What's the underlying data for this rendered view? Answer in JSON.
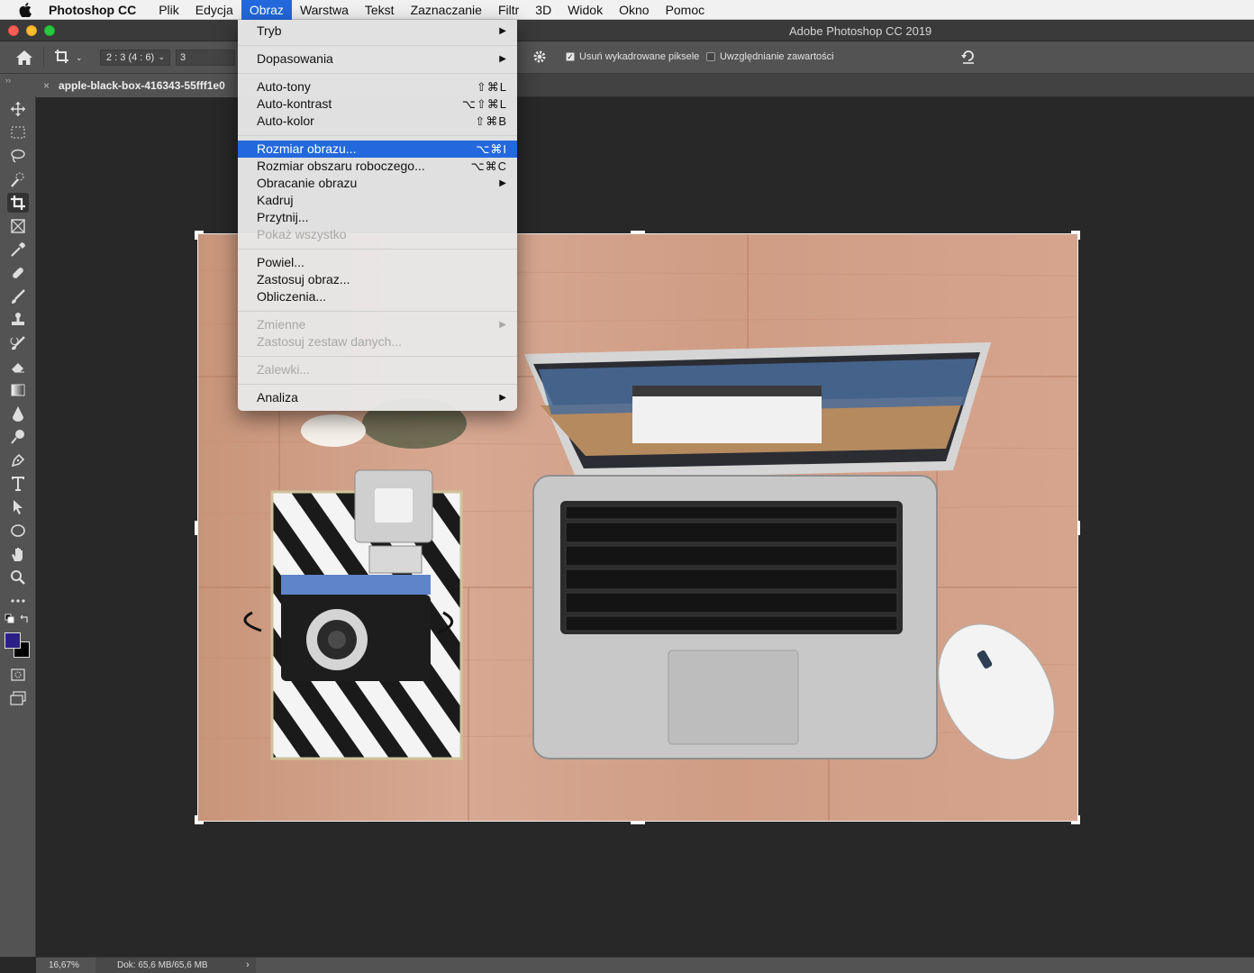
{
  "menubar": {
    "app_name": "Photoshop CC",
    "items": [
      "Plik",
      "Edycja",
      "Obraz",
      "Warstwa",
      "Tekst",
      "Zaznaczanie",
      "Filtr",
      "3D",
      "Widok",
      "Okno",
      "Pomoc"
    ],
    "active_item": "Obraz"
  },
  "window": {
    "title": "Adobe Photoshop CC 2019"
  },
  "options": {
    "ratio_value": "2 : 3 (4 : 6)",
    "ratio_field": "3",
    "delete_cropped_label": "Usuń wykadrowane piksele",
    "delete_cropped_checked": true,
    "content_aware_label": "Uwzględnianie zawartości",
    "content_aware_checked": false
  },
  "panel": {
    "collapse": "››"
  },
  "document": {
    "tab_name": "apple-black-box-416343-55fff1e0",
    "close": "×"
  },
  "menu": {
    "items": [
      {
        "label": "Tryb",
        "shortcut": "",
        "submenu": true,
        "disabled": false
      },
      {
        "separator": true
      },
      {
        "label": "Dopasowania",
        "shortcut": "",
        "submenu": true,
        "disabled": false
      },
      {
        "separator": true
      },
      {
        "label": "Auto-tony",
        "shortcut": "⇧⌘L",
        "submenu": false,
        "disabled": false
      },
      {
        "label": "Auto-kontrast",
        "shortcut": "⌥⇧⌘L",
        "submenu": false,
        "disabled": false
      },
      {
        "label": "Auto-kolor",
        "shortcut": "⇧⌘B",
        "submenu": false,
        "disabled": false
      },
      {
        "separator": true
      },
      {
        "label": "Rozmiar obrazu...",
        "shortcut": "⌥⌘I",
        "submenu": false,
        "disabled": false,
        "highlighted": true
      },
      {
        "label": "Rozmiar obszaru roboczego...",
        "shortcut": "⌥⌘C",
        "submenu": false,
        "disabled": false
      },
      {
        "label": "Obracanie obrazu",
        "shortcut": "",
        "submenu": true,
        "disabled": false
      },
      {
        "label": "Kadruj",
        "shortcut": "",
        "submenu": false,
        "disabled": false
      },
      {
        "label": "Przytnij...",
        "shortcut": "",
        "submenu": false,
        "disabled": false
      },
      {
        "label": "Pokaż wszystko",
        "shortcut": "",
        "submenu": false,
        "disabled": true
      },
      {
        "separator": true
      },
      {
        "label": "Powiel...",
        "shortcut": "",
        "submenu": false,
        "disabled": false
      },
      {
        "label": "Zastosuj obraz...",
        "shortcut": "",
        "submenu": false,
        "disabled": false
      },
      {
        "label": "Obliczenia...",
        "shortcut": "",
        "submenu": false,
        "disabled": false
      },
      {
        "separator": true
      },
      {
        "label": "Zmienne",
        "shortcut": "",
        "submenu": true,
        "disabled": true
      },
      {
        "label": "Zastosuj zestaw danych...",
        "shortcut": "",
        "submenu": false,
        "disabled": true
      },
      {
        "separator": true
      },
      {
        "label": "Zalewki...",
        "shortcut": "",
        "submenu": false,
        "disabled": true
      },
      {
        "separator": true
      },
      {
        "label": "Analiza",
        "shortcut": "",
        "submenu": true,
        "disabled": false
      }
    ]
  },
  "tools": [
    "move-icon",
    "marquee-icon",
    "lasso-icon",
    "quick-select-icon",
    "crop-icon",
    "frame-icon",
    "eyedropper-icon",
    "healing-icon",
    "brush-icon",
    "stamp-icon",
    "history-brush-icon",
    "eraser-icon",
    "gradient-icon",
    "blur-icon",
    "dodge-icon",
    "pen-icon",
    "type-icon",
    "path-select-icon",
    "ellipse-icon",
    "hand-icon",
    "zoom-icon",
    "more-icon"
  ],
  "colors": {
    "foreground": "#2c1f86",
    "background": "#000000",
    "accent": "#2369dd"
  },
  "status": {
    "zoom": "16,67%",
    "doc": "Dok: 65,6 MB/65,6 MB",
    "arrow": "›"
  }
}
